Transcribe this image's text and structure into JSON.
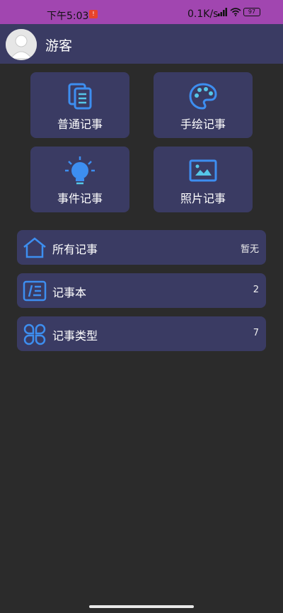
{
  "status_bar": {
    "time": "下午5:03",
    "notification_badge": "!",
    "network_speed": "0.1K/s",
    "battery": "97"
  },
  "header": {
    "username": "游客"
  },
  "tiles": [
    {
      "label": "普通记事",
      "icon": "document-notes-icon"
    },
    {
      "label": "手绘记事",
      "icon": "palette-icon"
    },
    {
      "label": "事件记事",
      "icon": "lightbulb-icon"
    },
    {
      "label": "照片记事",
      "icon": "image-icon"
    }
  ],
  "rows": [
    {
      "label": "所有记事",
      "count": "暂无",
      "icon": "home-icon"
    },
    {
      "label": "记事本",
      "count": "2",
      "icon": "notebook-icon"
    },
    {
      "label": "记事类型",
      "count": "7",
      "icon": "categories-icon"
    }
  ],
  "colors": {
    "accent_blue": "#3d8ef0",
    "accent_cyan": "#55c7e8",
    "card_bg": "#3a3b63",
    "page_bg": "#2b2b2b",
    "status_bar_bg": "#a146b0"
  }
}
